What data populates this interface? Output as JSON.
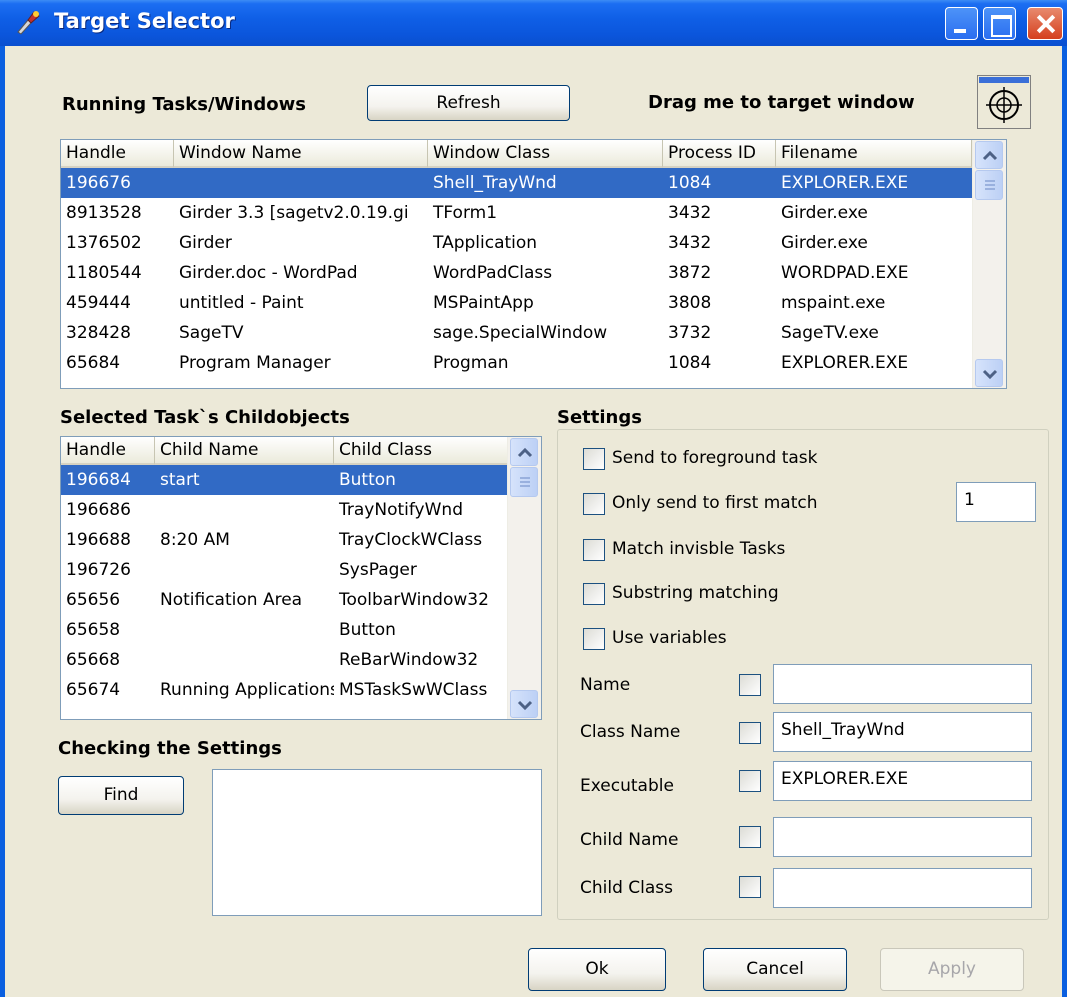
{
  "window": {
    "title": "Target Selector",
    "title_icon": "wrench-paint-icon"
  },
  "running": {
    "label": "Running Tasks/Windows",
    "refresh_label": "Refresh",
    "drag_label": "Drag me to target window",
    "drag_icon": "crosshair-target-icon",
    "columns": [
      "Handle",
      "Window Name",
      "Window Class",
      "Process ID",
      "Filename"
    ],
    "rows": [
      [
        "196676",
        "",
        "Shell_TrayWnd",
        "1084",
        "EXPLORER.EXE"
      ],
      [
        "8913528",
        "Girder 3.3 [sagetv2.0.19.gi",
        "TForm1",
        "3432",
        "Girder.exe"
      ],
      [
        "1376502",
        "Girder",
        "TApplication",
        "3432",
        "Girder.exe"
      ],
      [
        "1180544",
        "Girder.doc - WordPad",
        "WordPadClass",
        "3872",
        "WORDPAD.EXE"
      ],
      [
        "459444",
        "untitled - Paint",
        "MSPaintApp",
        "3808",
        "mspaint.exe"
      ],
      [
        "328428",
        "SageTV",
        "sage.SpecialWindow",
        "3732",
        "SageTV.exe"
      ],
      [
        "65684",
        "Program Manager",
        "Progman",
        "1084",
        "EXPLORER.EXE"
      ]
    ],
    "selected_row": 0
  },
  "children": {
    "label": "Selected Task`s Childobjects",
    "columns": [
      "Handle",
      "Child Name",
      "Child Class"
    ],
    "rows": [
      [
        "196684",
        "start",
        "Button"
      ],
      [
        "196686",
        "",
        "TrayNotifyWnd"
      ],
      [
        "196688",
        "8:20 AM",
        "TrayClockWClass"
      ],
      [
        "196726",
        "",
        "SysPager"
      ],
      [
        "65656",
        "Notification Area",
        "ToolbarWindow32"
      ],
      [
        "65658",
        "",
        "Button"
      ],
      [
        "65668",
        "",
        "ReBarWindow32"
      ],
      [
        "65674",
        "Running Applications",
        "MSTaskSwWClass"
      ]
    ],
    "selected_row": 0
  },
  "checking": {
    "label": "Checking the Settings",
    "find_label": "Find",
    "result_text": ""
  },
  "settings": {
    "label": "Settings",
    "options": [
      {
        "label": "Send to foreground task",
        "checked": false
      },
      {
        "label": "Only send to first match",
        "checked": false
      },
      {
        "label": "Match invisble Tasks",
        "checked": false
      },
      {
        "label": "Substring matching",
        "checked": false
      },
      {
        "label": "Use variables",
        "checked": false
      }
    ],
    "first_match_count": "1",
    "fields": [
      {
        "label": "Name",
        "checked": false,
        "value": ""
      },
      {
        "label": "Class Name",
        "checked": false,
        "value": "Shell_TrayWnd"
      },
      {
        "label": "Executable",
        "checked": false,
        "value": "EXPLORER.EXE"
      },
      {
        "label": "Child Name",
        "checked": false,
        "value": ""
      },
      {
        "label": "Child Class",
        "checked": false,
        "value": ""
      }
    ]
  },
  "footer": {
    "ok_label": "Ok",
    "cancel_label": "Cancel",
    "apply_label": "Apply",
    "apply_enabled": false
  }
}
